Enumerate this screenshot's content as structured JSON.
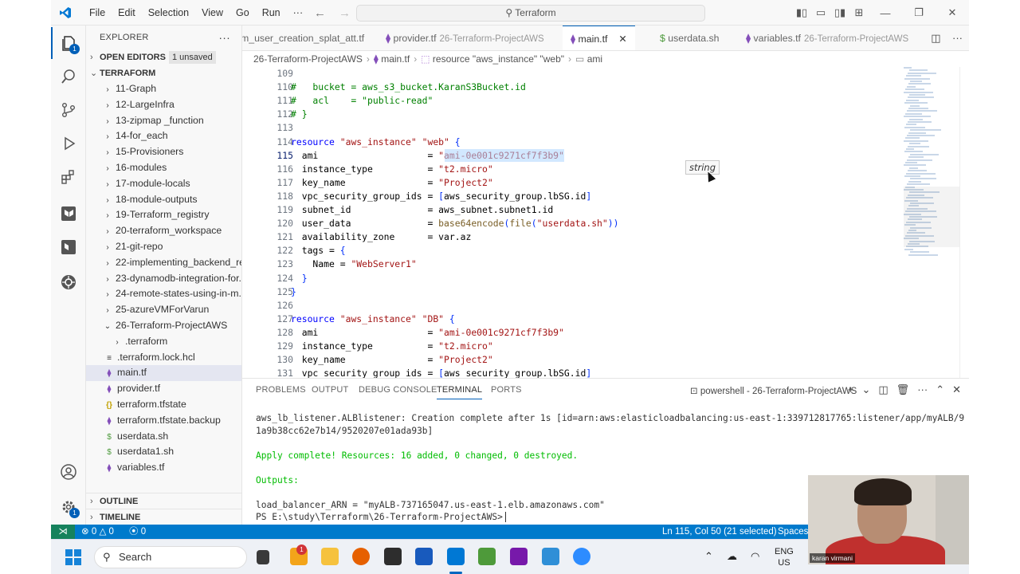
{
  "titlebar": {
    "menus": [
      "File",
      "Edit",
      "Selection",
      "View",
      "Go",
      "Run",
      "···"
    ],
    "search": "Terraform"
  },
  "explorer": {
    "title": "EXPLORER",
    "open_editors": "OPEN EDITORS",
    "unsaved_badge": "1 unsaved",
    "root": "TERRAFORM",
    "items": [
      {
        "label": "11-Graph",
        "type": "folder"
      },
      {
        "label": "12-LargeInfra",
        "type": "folder"
      },
      {
        "label": "13-zipmap _function",
        "type": "folder"
      },
      {
        "label": "14-for_each",
        "type": "folder"
      },
      {
        "label": "15-Provisioners",
        "type": "folder"
      },
      {
        "label": "16-modules",
        "type": "folder"
      },
      {
        "label": "17-module-locals",
        "type": "folder"
      },
      {
        "label": "18-module-outputs",
        "type": "folder"
      },
      {
        "label": "19-Terraform_registry",
        "type": "folder"
      },
      {
        "label": "20-terraform_workspace",
        "type": "folder"
      },
      {
        "label": "21-git-repo",
        "type": "folder"
      },
      {
        "label": "22-implementing_backend_re...",
        "type": "folder"
      },
      {
        "label": "23-dynamodb-integration-for...",
        "type": "folder"
      },
      {
        "label": "24-remote-states-using-in-m...",
        "type": "folder"
      },
      {
        "label": "25-azureVMForVarun",
        "type": "folder"
      },
      {
        "label": "26-Terraform-ProjectAWS",
        "type": "folder-open"
      },
      {
        "label": ".terraform",
        "type": "subfolder"
      },
      {
        "label": ".terraform.lock.hcl",
        "type": "lock"
      },
      {
        "label": "main.tf",
        "type": "tf",
        "selected": true
      },
      {
        "label": "provider.tf",
        "type": "tf"
      },
      {
        "label": "terraform.tfstate",
        "type": "json"
      },
      {
        "label": "terraform.tfstate.backup",
        "type": "tf"
      },
      {
        "label": "userdata.sh",
        "type": "sh"
      },
      {
        "label": "userdata1.sh",
        "type": "sh"
      },
      {
        "label": "variables.tf",
        "type": "tf"
      }
    ],
    "outline": "OUTLINE",
    "timeline": "TIMELINE"
  },
  "tabs": [
    {
      "label": "m_user_creation_splat_att.tf",
      "sub": ""
    },
    {
      "label": "provider.tf",
      "sub": "26-Terraform-ProjectAWS"
    },
    {
      "label": "main.tf",
      "sub": "",
      "active": true
    },
    {
      "label": "userdata.sh",
      "sub": ""
    },
    {
      "label": "variables.tf",
      "sub": "26-Terraform-ProjectAWS"
    }
  ],
  "breadcrumb": [
    "26-Terraform-ProjectAWS",
    "main.tf",
    "resource \"aws_instance\" \"web\"",
    "ami"
  ],
  "editor": {
    "hover_tooltip": "string",
    "lines": [
      {
        "n": "109",
        "t": ""
      },
      {
        "n": "110",
        "t": "#   bucket = aws_s3_bucket.KaranS3Bucket.id"
      },
      {
        "n": "111",
        "t": "#   acl    = \"public-read\""
      },
      {
        "n": "112",
        "t": "# }"
      },
      {
        "n": "113",
        "t": ""
      },
      {
        "n": "114",
        "t": "resource \"aws_instance\" \"web\" {"
      },
      {
        "n": "115",
        "t": "  ami                    = \"ami-0e001c9271cf7f3b9\""
      },
      {
        "n": "116",
        "t": "  instance_type          = \"t2.micro\""
      },
      {
        "n": "117",
        "t": "  key_name               = \"Project2\""
      },
      {
        "n": "118",
        "t": "  vpc_security_group_ids = [aws_security_group.lbSG.id]"
      },
      {
        "n": "119",
        "t": "  subnet_id              = aws_subnet.subnet1.id"
      },
      {
        "n": "120",
        "t": "  user_data              = base64encode(file(\"userdata.sh\"))"
      },
      {
        "n": "121",
        "t": "  availability_zone      = var.az"
      },
      {
        "n": "122",
        "t": "  tags = {"
      },
      {
        "n": "123",
        "t": "    Name = \"WebServer1\""
      },
      {
        "n": "124",
        "t": "  }"
      },
      {
        "n": "125",
        "t": "}"
      },
      {
        "n": "126",
        "t": ""
      },
      {
        "n": "127",
        "t": "resource \"aws_instance\" \"DB\" {"
      },
      {
        "n": "128",
        "t": "  ami                    = \"ami-0e001c9271cf7f3b9\""
      },
      {
        "n": "129",
        "t": "  instance_type          = \"t2.micro\""
      },
      {
        "n": "130",
        "t": "  key_name               = \"Project2\""
      },
      {
        "n": "131",
        "t": "  vpc_security_group_ids = [aws_security_group.lbSG.id]"
      }
    ]
  },
  "panel": {
    "tabs": [
      "PROBLEMS",
      "OUTPUT",
      "DEBUG CONSOLE",
      "TERMINAL",
      "PORTS"
    ],
    "terminal_title": "powershell - 26-Terraform-ProjectAWS",
    "lines": [
      "aws_lb_listener.ALBlistener: Creation complete after 1s [id=arn:aws:elasticloadbalancing:us-east-1:339712817765:listener/app/myALB/9",
      "1a9b38cc62e7b14/9520207e01ada93b]",
      "",
      "Apply complete! Resources: 16 added, 0 changed, 0 destroyed.",
      "",
      "Outputs:",
      "",
      "load_balancer_ARN = \"myALB-737165047.us-east-1.elb.amazonaws.com\"",
      "PS E:\\study\\Terraform\\26-Terraform-ProjectAWS> "
    ]
  },
  "statusbar": {
    "errors": "0",
    "warnings": "0",
    "ports": "0",
    "position": "Ln 115, Col 50 (21 selected)",
    "spaces": "Spaces:"
  },
  "taskbar": {
    "search": "Search",
    "lang_top": "ENG",
    "lang_bottom": "US",
    "notification_count": "1"
  },
  "webcam": {
    "name": "karan virmani"
  }
}
